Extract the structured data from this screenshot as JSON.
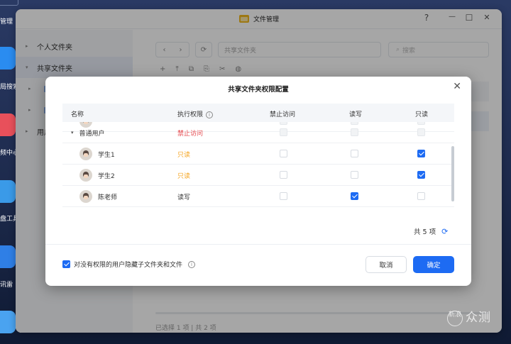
{
  "desktop": {
    "dock_labels": [
      "管理",
      "局搜索",
      "频中心",
      "盘工具",
      "讯雷"
    ]
  },
  "window": {
    "title": "文件管理",
    "controls": {
      "help": "?",
      "minimize": "—",
      "maximize": "☐",
      "close": "✕"
    }
  },
  "sidebar": {
    "items": [
      {
        "label": "个人文件夹",
        "caret": "▸"
      },
      {
        "label": "共享文件夹",
        "caret": "▾"
      },
      {
        "label": "用户",
        "caret": "▸"
      }
    ]
  },
  "main": {
    "nav": {
      "back": "‹",
      "forward": "›",
      "refresh": "⟳"
    },
    "path_placeholder": "共享文件夹",
    "search_placeholder": "搜索",
    "toolbar": [
      "+",
      "⤒",
      "⧉",
      "⎘",
      "✂",
      "◍"
    ],
    "status": "已选择 1 项 | 共 2 项"
  },
  "dialog": {
    "title": "共享文件夹权限配置",
    "close": "✕",
    "headers": {
      "name": "名称",
      "permission": "执行权限",
      "deny": "禁止访问",
      "readwrite": "读写",
      "readonly": "只读"
    },
    "rows": [
      {
        "name": "",
        "type": "user",
        "permission": "",
        "perm_color": "#333333",
        "deny": false,
        "readwrite": false,
        "readonly": false,
        "disabled": true,
        "partial": true
      },
      {
        "name": "普通用户",
        "type": "group",
        "caret": "▾",
        "permission": "禁止访问",
        "perm_color": "#e5484d",
        "deny": false,
        "readwrite": false,
        "readonly": false,
        "disabled": true
      },
      {
        "name": "学生1",
        "type": "user",
        "permission": "只读",
        "perm_color": "#f5a623",
        "deny": false,
        "readwrite": false,
        "readonly": true,
        "disabled": false
      },
      {
        "name": "学生2",
        "type": "user",
        "permission": "只读",
        "perm_color": "#f5a623",
        "deny": false,
        "readwrite": false,
        "readonly": true,
        "disabled": false
      },
      {
        "name": "陈老师",
        "type": "user",
        "permission": "读写",
        "perm_color": "#333333",
        "deny": false,
        "readwrite": true,
        "readonly": false,
        "disabled": false
      }
    ],
    "total": "共 5 项",
    "hide_option": {
      "label": "对没有权限的用户隐藏子文件夹和文件",
      "checked": true
    },
    "cancel_label": "取消",
    "ok_label": "确定"
  },
  "watermark": {
    "circle": "新浪",
    "text": "众测"
  },
  "colors": {
    "accent": "#1d6bf3",
    "deny": "#e5484d",
    "readonly": "#f5a623"
  }
}
